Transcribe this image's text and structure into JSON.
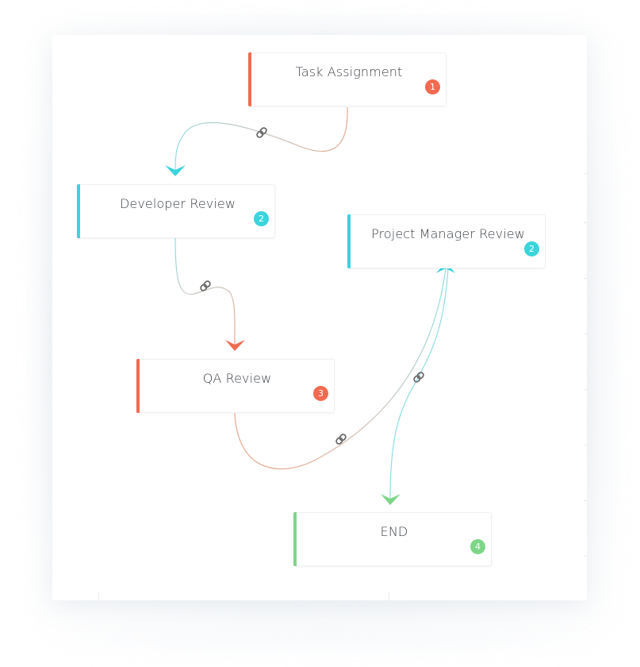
{
  "colors": {
    "orange": "#f26b50",
    "cyan": "#3ad4dc",
    "green": "#7dd687",
    "edge_orange": "#e8a88e",
    "edge_cyan": "#8fdde2",
    "link_icon": "#6b6b6b"
  },
  "nodes": [
    {
      "id": "task-assignment",
      "label": "Task Assignment",
      "step": "1",
      "color": "#f26b50"
    },
    {
      "id": "developer-review",
      "label": "Developer Review",
      "step": "2",
      "color": "#3ad4dc"
    },
    {
      "id": "project-manager-review",
      "label": "Project Manager Review",
      "step": "2",
      "color": "#3ad4dc"
    },
    {
      "id": "qa-review",
      "label": "QA Review",
      "step": "3",
      "color": "#f26b50"
    },
    {
      "id": "end",
      "label": "END",
      "step": "4",
      "color": "#7dd687"
    }
  ],
  "edges": [
    {
      "from": "task-assignment",
      "to": "developer-review",
      "icon": "link-icon"
    },
    {
      "from": "developer-review",
      "to": "qa-review",
      "icon": "link-icon"
    },
    {
      "from": "qa-review",
      "to": "project-manager-review",
      "icon": "link-icon"
    },
    {
      "from": "project-manager-review",
      "to": "end",
      "icon": "link-icon"
    }
  ]
}
